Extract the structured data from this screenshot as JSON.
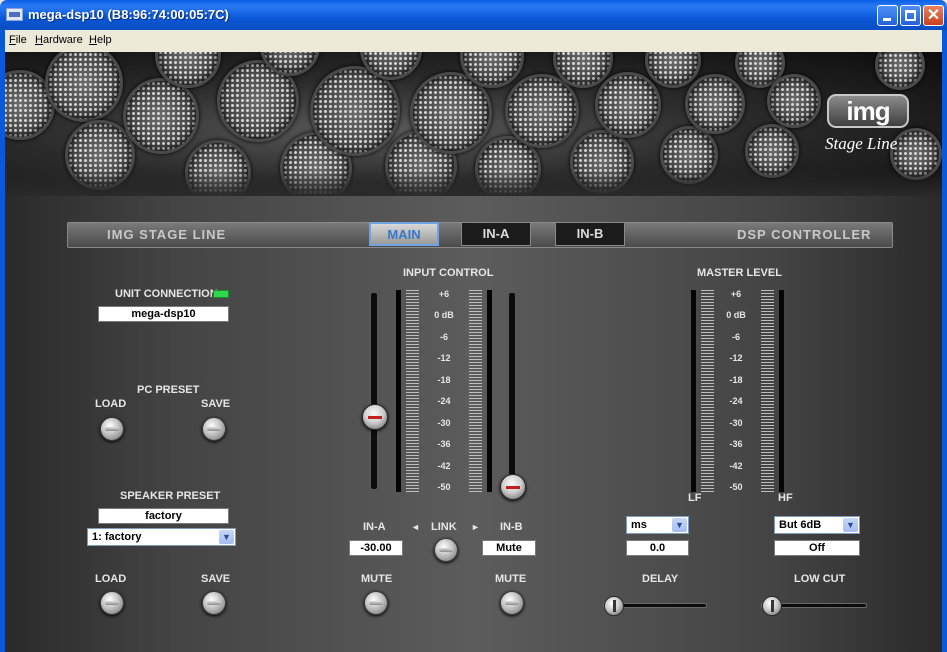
{
  "window": {
    "title": "mega-dsp10 (B8:96:74:00:05:7C)",
    "close_glyph": "✕"
  },
  "menu": [
    "File",
    "Hardware",
    "Help"
  ],
  "banner": {
    "logo": "img",
    "tagline": "Stage Line"
  },
  "header": {
    "left": "IMG STAGE LINE",
    "right": "DSP CONTROLLER",
    "tabs": [
      "MAIN",
      "IN-A",
      "IN-B"
    ],
    "active_tab": "MAIN"
  },
  "unit": {
    "label": "UNIT CONNECTION",
    "name": "mega-dsp10",
    "led_color": "#2fd84a"
  },
  "pc_preset": {
    "title": "PC PRESET",
    "load": "LOAD",
    "save": "SAVE"
  },
  "speaker_preset": {
    "title": "SPEAKER PRESET",
    "name": "factory",
    "selected": "1: factory",
    "load": "LOAD",
    "save": "SAVE"
  },
  "input_control": {
    "title": "INPUT CONTROL",
    "scale": [
      "+6",
      "0 dB",
      "-6",
      "-12",
      "-18",
      "-24",
      "-30",
      "-36",
      "-42",
      "-50"
    ],
    "in_a_label": "IN-A",
    "in_b_label": "IN-B",
    "link_label": "LINK",
    "link_left": "◄",
    "link_right": "►",
    "in_a_value": "-30.00",
    "in_b_value": "Mute",
    "mute_a": "MUTE",
    "mute_b": "MUTE"
  },
  "master": {
    "title": "MASTER LEVEL",
    "scale": [
      "+6",
      "0 dB",
      "-6",
      "-12",
      "-18",
      "-24",
      "-30",
      "-36",
      "-42",
      "-50"
    ],
    "lf": "LF",
    "hf": "HF"
  },
  "delay": {
    "unit": "ms",
    "value": "0.0",
    "label": "DELAY"
  },
  "lowcut": {
    "filter": "But 6dB",
    "value": "Off",
    "label": "LOW CUT"
  },
  "combo_arrow": "▼"
}
